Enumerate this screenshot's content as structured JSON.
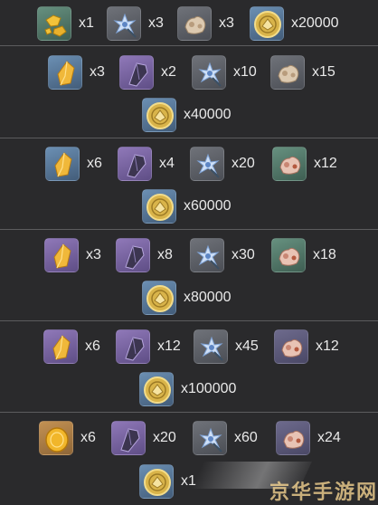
{
  "rows": [
    {
      "lines": [
        [
          {
            "icon": "gold-nugget-icon",
            "qty": "x1"
          },
          {
            "icon": "blue-flower-icon",
            "qty": "x3"
          },
          {
            "icon": "beige-mineral-icon",
            "qty": "x3"
          },
          {
            "icon": "mora-coin-icon",
            "qty": "x20000"
          }
        ]
      ]
    },
    {
      "lines": [
        [
          {
            "icon": "amber-crystal-icon",
            "qty": "x3"
          },
          {
            "icon": "dark-shard-icon",
            "qty": "x2"
          },
          {
            "icon": "blue-flower-icon",
            "qty": "x10"
          },
          {
            "icon": "beige-mineral-icon",
            "qty": "x15"
          }
        ],
        [
          {
            "icon": "mora-coin-icon",
            "qty": "x40000"
          }
        ]
      ]
    },
    {
      "lines": [
        [
          {
            "icon": "amber-crystal-icon",
            "qty": "x6"
          },
          {
            "icon": "dark-shard-icon",
            "qty": "x4"
          },
          {
            "icon": "blue-flower-icon",
            "qty": "x20"
          },
          {
            "icon": "pink-mineral-icon",
            "qty": "x12"
          }
        ],
        [
          {
            "icon": "mora-coin-icon",
            "qty": "x60000"
          }
        ]
      ]
    },
    {
      "lines": [
        [
          {
            "icon": "amber-crystal-icon",
            "qty": "x3"
          },
          {
            "icon": "dark-shard-icon",
            "qty": "x8"
          },
          {
            "icon": "blue-flower-icon",
            "qty": "x30"
          },
          {
            "icon": "pink-mineral-icon",
            "qty": "x18"
          }
        ],
        [
          {
            "icon": "mora-coin-icon",
            "qty": "x80000"
          }
        ]
      ]
    },
    {
      "lines": [
        [
          {
            "icon": "amber-crystal-icon",
            "qty": "x6"
          },
          {
            "icon": "dark-shard-icon",
            "qty": "x12"
          },
          {
            "icon": "blue-flower-icon",
            "qty": "x45"
          },
          {
            "icon": "pink-mineral-icon",
            "qty": "x12"
          }
        ],
        [
          {
            "icon": "mora-coin-icon",
            "qty": "x100000"
          }
        ]
      ]
    },
    {
      "lines": [
        [
          {
            "icon": "gold-gem-icon",
            "qty": "x6"
          },
          {
            "icon": "dark-shard-icon",
            "qty": "x20"
          },
          {
            "icon": "blue-flower-icon",
            "qty": "x60"
          },
          {
            "icon": "pink-mineral-icon",
            "qty": "x24"
          }
        ],
        [
          {
            "icon": "mora-coin-icon",
            "qty": "x1"
          }
        ]
      ]
    }
  ],
  "watermark": {
    "text": "京华手游网"
  }
}
